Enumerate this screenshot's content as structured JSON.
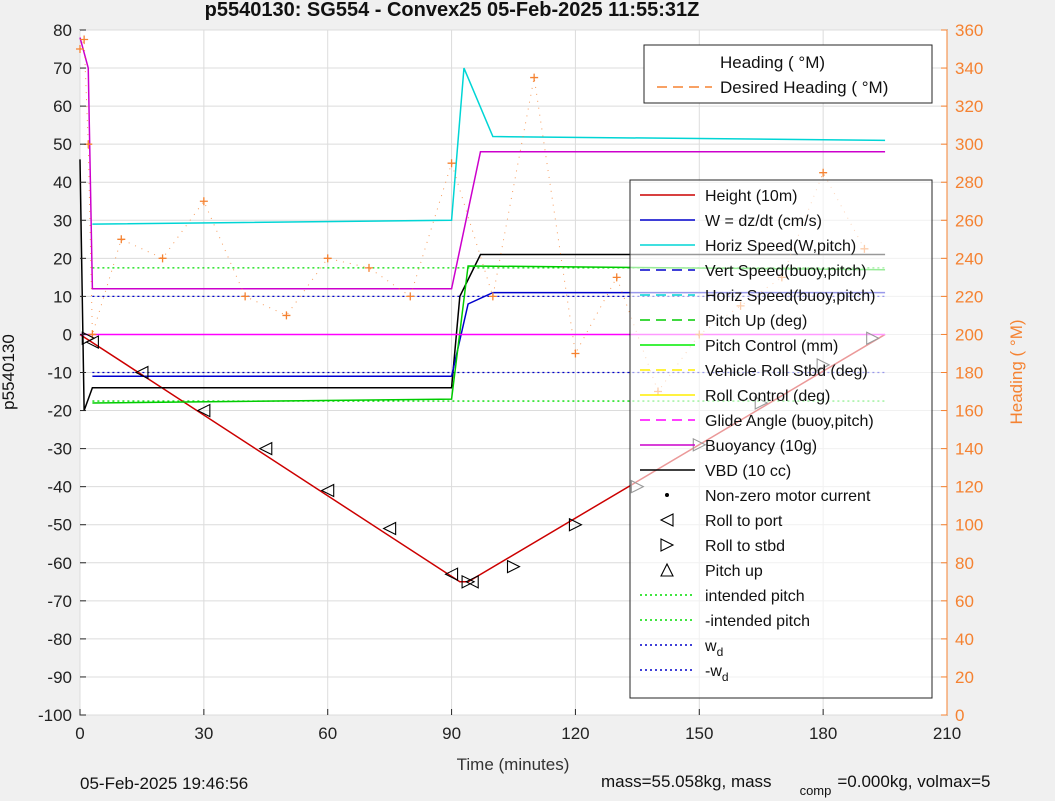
{
  "chart_data": {
    "type": "line",
    "title": "p5540130: SG554 - Convex25 05-Feb-2025 11:55:31Z",
    "xlabel": "Time (minutes)",
    "ylabel": "p5540130",
    "y2label": "Heading ( °M)",
    "xlim": [
      0,
      210
    ],
    "ylim": [
      -100,
      80
    ],
    "y2lim": [
      0,
      360
    ],
    "xticks": [
      0,
      30,
      60,
      90,
      120,
      150,
      180,
      210
    ],
    "yticks": [
      -100,
      -90,
      -80,
      -70,
      -60,
      -50,
      -40,
      -30,
      -20,
      -10,
      0,
      10,
      20,
      30,
      40,
      50,
      60,
      70,
      80
    ],
    "y2ticks": [
      0,
      20,
      40,
      60,
      80,
      100,
      120,
      140,
      160,
      180,
      200,
      220,
      240,
      260,
      280,
      300,
      320,
      340,
      360
    ],
    "grid": true,
    "legend_position": [
      "top-right",
      "right"
    ],
    "legend_heading": [
      {
        "label": "Heading ( °M)",
        "color": "#f58231",
        "style": "plus"
      },
      {
        "label": "Desired Heading ( °M)",
        "color": "#f58231",
        "style": "dash"
      }
    ],
    "legend_main": [
      {
        "label": "Height (10m)",
        "color": "#cc0000",
        "style": "line"
      },
      {
        "label": "W = dz/dt (cm/s)",
        "color": "#0000cc",
        "style": "line"
      },
      {
        "label": "Horiz Speed(W,pitch)",
        "color": "#00d5d5",
        "style": "line"
      },
      {
        "label": "Vert Speed(buoy,pitch)",
        "color": "#0000cc",
        "style": "dash"
      },
      {
        "label": "Horiz Speed(buoy,pitch)",
        "color": "#00d5d5",
        "style": "dash"
      },
      {
        "label": "Pitch Up (deg)",
        "color": "#00cc00",
        "style": "dash"
      },
      {
        "label": "Pitch Control (mm)",
        "color": "#00ee00",
        "style": "line"
      },
      {
        "label": "Vehicle Roll Stbd (deg)",
        "color": "#ffee00",
        "style": "dash"
      },
      {
        "label": "Roll Control (deg)",
        "color": "#ffee00",
        "style": "line"
      },
      {
        "label": "Glide Angle (buoy,pitch)",
        "color": "#ff00ff",
        "style": "dash"
      },
      {
        "label": "Buoyancy (10g)",
        "color": "#cc00cc",
        "style": "line"
      },
      {
        "label": "VBD (10 cc)",
        "color": "#000000",
        "style": "line"
      },
      {
        "label": "Non-zero motor current",
        "color": "#000000",
        "style": "dot"
      },
      {
        "label": "Roll to port",
        "color": "#000000",
        "style": "tri-left"
      },
      {
        "label": "Roll to stbd",
        "color": "#000000",
        "style": "tri-right"
      },
      {
        "label": "Pitch up",
        "color": "#000000",
        "style": "tri-up"
      },
      {
        "label": "intended pitch",
        "color": "#00dd00",
        "style": "dot-line"
      },
      {
        "label": "-intended pitch",
        "color": "#00dd00",
        "style": "dot-line"
      },
      {
        "label": "w_d",
        "color": "#0000cc",
        "style": "dot-line"
      },
      {
        "label": "-w_d",
        "color": "#0000cc",
        "style": "dot-line"
      }
    ],
    "series": [
      {
        "name": "Height (10m)",
        "color": "#cc0000",
        "x": [
          0,
          92,
          94,
          195
        ],
        "y": [
          0,
          -65,
          -65,
          0
        ]
      },
      {
        "name": "Buoyancy (10g)",
        "color": "#cc00cc",
        "x": [
          0,
          2,
          3,
          90,
          97,
          110,
          195
        ],
        "y": [
          78,
          70,
          12,
          12,
          48,
          48,
          48
        ]
      },
      {
        "name": "VBD (10 cc)",
        "color": "#000000",
        "x": [
          0,
          1,
          3,
          90,
          92,
          97,
          195
        ],
        "y": [
          46,
          -20,
          -14,
          -14,
          10,
          21,
          21
        ]
      },
      {
        "name": "W = dz/dt (cm/s)",
        "color": "#0000cc",
        "x": [
          3,
          90,
          94,
          100,
          195
        ],
        "y": [
          -11,
          -11,
          8,
          11,
          11
        ]
      },
      {
        "name": "Horiz Speed(W,pitch)",
        "color": "#00d5d5",
        "x": [
          3,
          90,
          93,
          100,
          195
        ],
        "y": [
          29,
          30,
          70,
          52,
          51
        ]
      },
      {
        "name": "Pitch Up (deg)",
        "color": "#00cc00",
        "x": [
          3,
          90,
          94,
          195
        ],
        "y": [
          -18,
          -17,
          18,
          17
        ]
      },
      {
        "name": "Glide Angle (buoy,pitch)",
        "color": "#ff00ff",
        "x": [
          0,
          195
        ],
        "y": [
          0,
          0
        ]
      }
    ],
    "reference_lines": [
      {
        "name": "intended pitch",
        "color": "#00dd00",
        "y": 17.5
      },
      {
        "name": "-intended pitch",
        "color": "#00dd00",
        "y": -17.5
      },
      {
        "name": "w_d",
        "color": "#0000cc",
        "y": 10
      },
      {
        "name": "-w_d",
        "color": "#0000cc",
        "y": -10
      }
    ],
    "heading_x": [
      0,
      1,
      2,
      3,
      10,
      20,
      30,
      40,
      50,
      60,
      70,
      80,
      90,
      100,
      110,
      120,
      130,
      140,
      150,
      160,
      170,
      180,
      190
    ],
    "heading_y": [
      350,
      355,
      300,
      200,
      250,
      240,
      270,
      220,
      210,
      240,
      235,
      220,
      290,
      220,
      335,
      190,
      230,
      170,
      200,
      215,
      230,
      285,
      245
    ],
    "roll_to_stbd_x": [
      2,
      94,
      105,
      120,
      135,
      150,
      165,
      180,
      192
    ],
    "roll_to_stbd_y": [
      -1,
      -65,
      -61,
      -50,
      -40,
      -29,
      -18,
      -8,
      -1
    ],
    "roll_to_port_x": [
      3,
      15,
      30,
      45,
      60,
      75,
      90,
      95
    ],
    "roll_to_port_y": [
      -2,
      -10,
      -20,
      -30,
      -41,
      -51,
      -63,
      -65
    ]
  },
  "footer": {
    "date": "05-Feb-2025 19:46:56",
    "mass_left": "mass=55.058kg, mass",
    "mass_sub": "comp",
    "mass_right": "=0.000kg, volmax=5"
  }
}
